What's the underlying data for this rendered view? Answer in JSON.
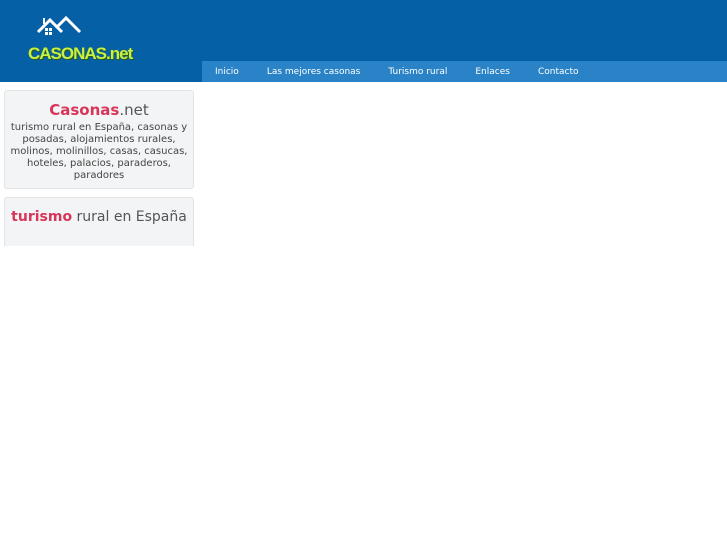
{
  "header": {
    "logo": {
      "name": "CASONAS",
      "tld": ".net",
      "icon": "house-roof-icon"
    }
  },
  "nav": {
    "items": [
      {
        "label": "Inicio"
      },
      {
        "label": "Las mejores casonas"
      },
      {
        "label": "Turismo rural"
      },
      {
        "label": "Enlaces"
      },
      {
        "label": "Contacto"
      }
    ]
  },
  "sidebar": {
    "intro": {
      "title_highlight": "Casonas",
      "title_rest": ".net",
      "body": "turismo rural en España, casonas y posadas, alojamientos rurales, molinos, molinillos, casas, casucas, hoteles, palacios, paraderos, paradores"
    },
    "section": {
      "title_highlight": "turismo",
      "title_rest": " rural en España"
    }
  },
  "colors": {
    "header_bg": "#0660a5",
    "nav_bg": "#2a83c6",
    "accent": "#d8355a",
    "logo_green": "#c6f04a"
  }
}
